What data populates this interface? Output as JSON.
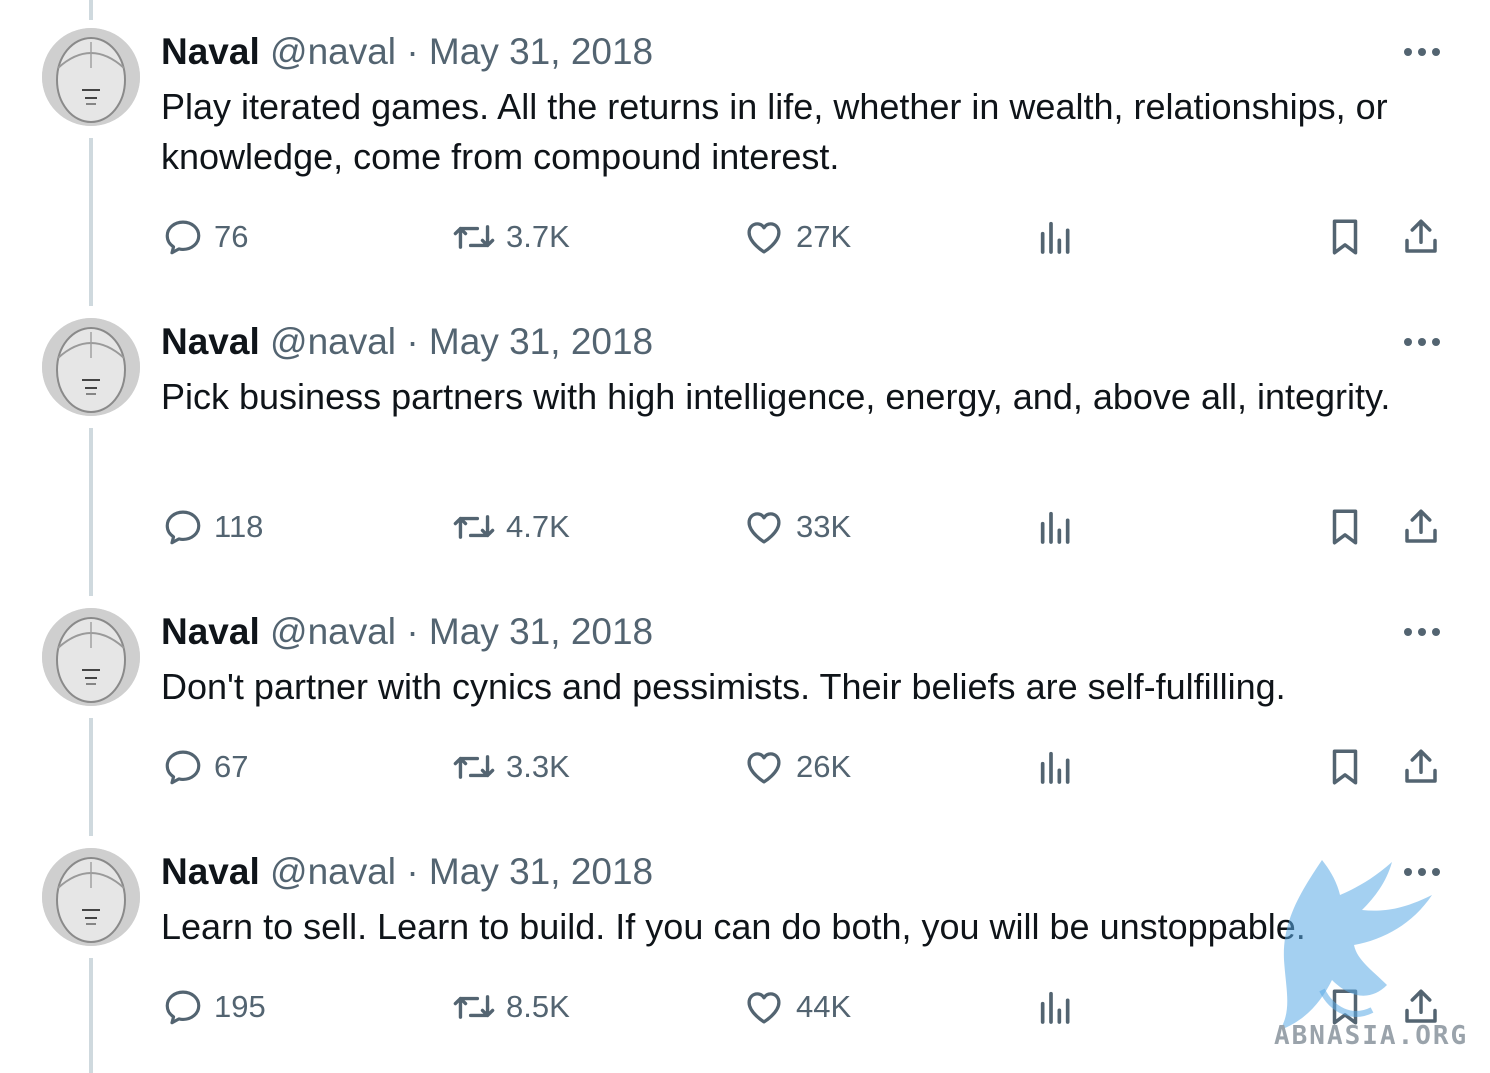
{
  "tweets": [
    {
      "author": "Naval",
      "handle": "@naval",
      "separator": "·",
      "date": "May 31, 2018",
      "text": "Play iterated games. All the returns in life, whether in wealth, relationships, or knowledge, come from compound interest.",
      "replies": "76",
      "retweets": "3.7K",
      "likes": "27K"
    },
    {
      "author": "Naval",
      "handle": "@naval",
      "separator": "·",
      "date": "May 31, 2018",
      "text": "Pick business partners with high intelligence, energy, and, above all, integrity.",
      "replies": "118",
      "retweets": "4.7K",
      "likes": "33K"
    },
    {
      "author": "Naval",
      "handle": "@naval",
      "separator": "·",
      "date": "May 31, 2018",
      "text": "Don't partner with cynics and pessimists. Their beliefs are self-fulfilling.",
      "replies": "67",
      "retweets": "3.3K",
      "likes": "26K"
    },
    {
      "author": "Naval",
      "handle": "@naval",
      "separator": "·",
      "date": "May 31, 2018",
      "text": "Learn to sell. Learn to build. If you can do both, you will be unstoppable.",
      "replies": "195",
      "retweets": "8.5K",
      "likes": "44K"
    }
  ],
  "icons": {
    "reply": "reply-icon",
    "retweet": "retweet-icon",
    "like": "heart-icon",
    "views": "views-icon",
    "bookmark": "bookmark-icon",
    "share": "share-icon",
    "more": "more-icon"
  },
  "colors": {
    "text": "#0f1419",
    "secondary": "#536471",
    "thread_line": "#cfd9de",
    "watermark": "#5aa9e6"
  },
  "watermark": {
    "text": "ABNASIA.ORG"
  }
}
